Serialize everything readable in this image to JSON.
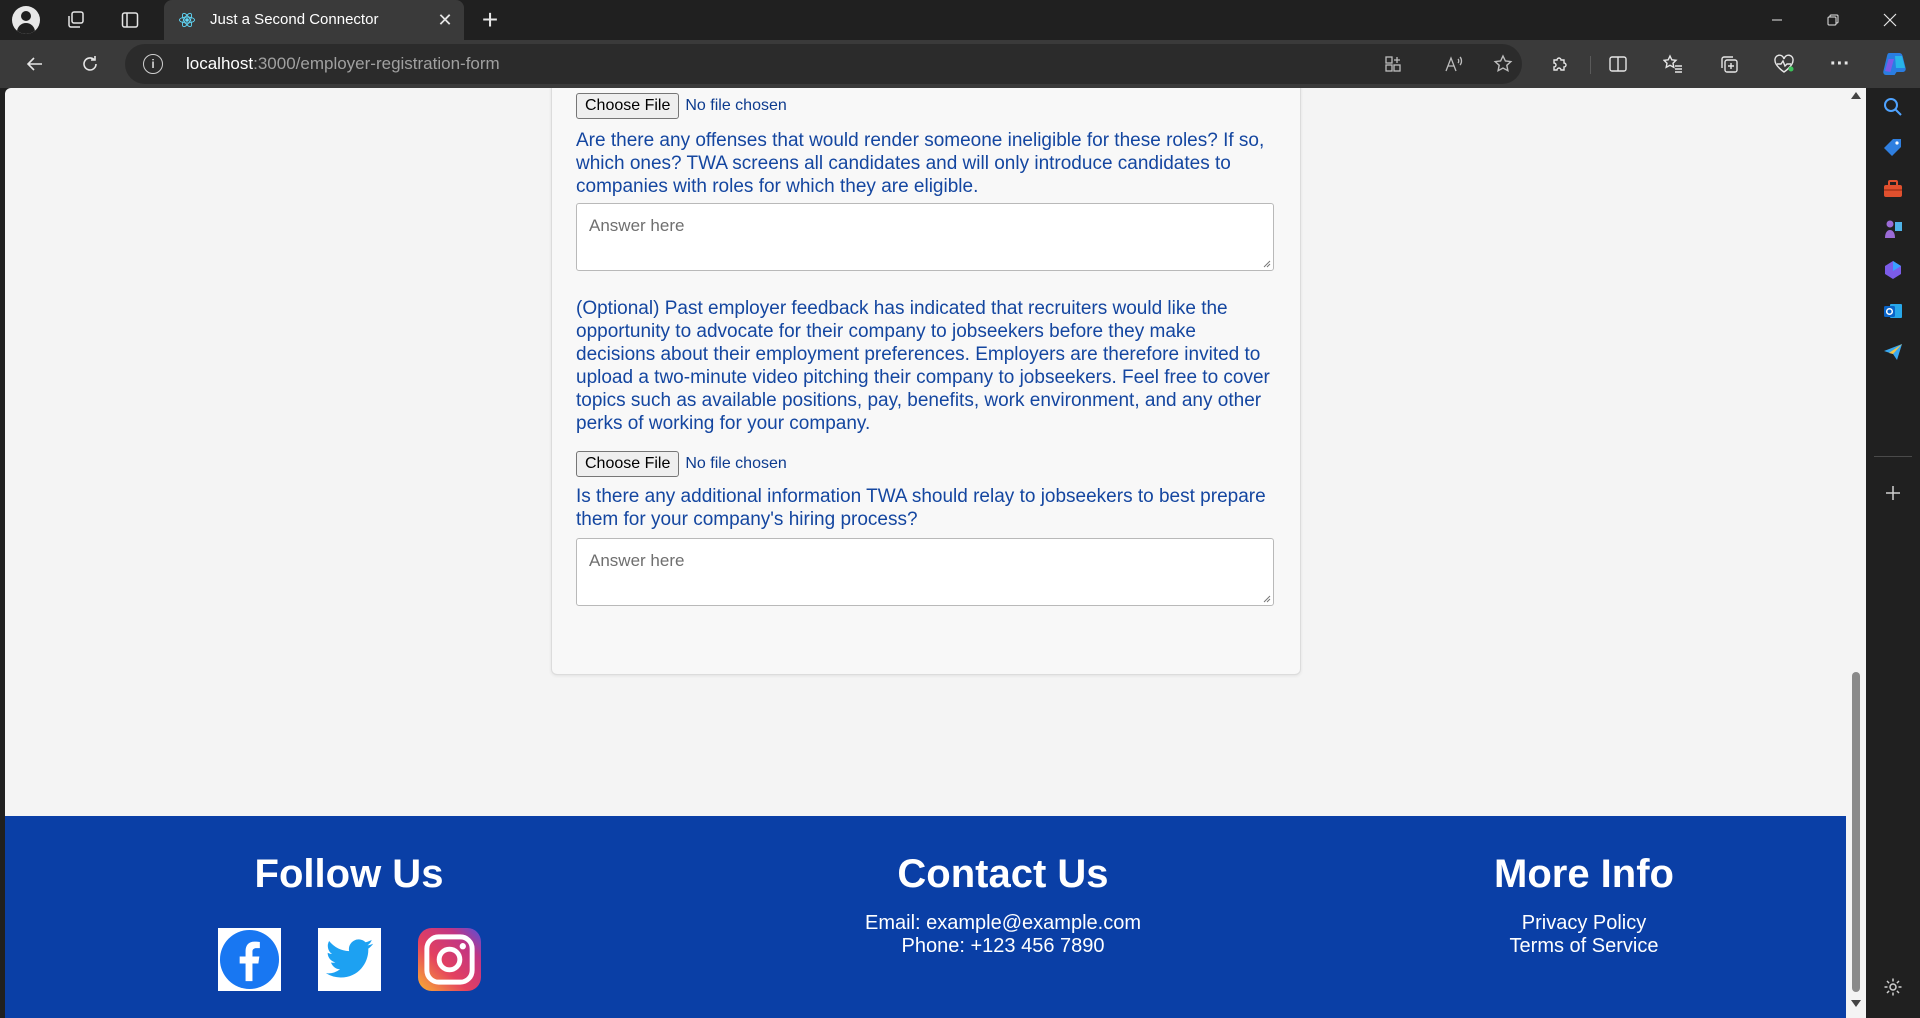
{
  "browser": {
    "tab_title": "Just a Second Connector",
    "url_host": "localhost",
    "url_rest": ":3000/employer-registration-form",
    "tab_close_glyph": "✕",
    "new_tab_glyph": "+",
    "more_glyph": "···"
  },
  "form": {
    "file_inputs": [
      {
        "button": "Choose File",
        "status": "No file chosen"
      },
      {
        "button": "Choose File",
        "status": "No file chosen"
      }
    ],
    "questions": [
      {
        "label": "Are there any offenses that would render someone ineligible for these roles? If so, which ones? TWA screens all candidates and will only introduce candidates to companies with roles for which they are eligible.",
        "placeholder": "Answer here"
      },
      {
        "label": "(Optional) Past employer feedback has indicated that recruiters would like the opportunity to advocate for their company to jobseekers before they make decisions about their employment preferences. Employers are therefore invited to upload a two-minute video pitching their company to jobseekers. Feel free to cover topics such as available positions, pay, benefits, work environment, and any other perks of working for your company."
      },
      {
        "label": "Is there any additional information TWA should relay to jobseekers to best prepare them for your company's hiring process?",
        "placeholder": "Answer here"
      }
    ]
  },
  "footer": {
    "follow": {
      "heading": "Follow Us",
      "icons": [
        "facebook-icon",
        "twitter-icon",
        "instagram-icon"
      ]
    },
    "contact": {
      "heading": "Contact Us",
      "email": "Email: example@example.com",
      "phone": "Phone: +123 456 7890"
    },
    "more_info": {
      "heading": "More Info",
      "privacy": "Privacy Policy",
      "terms": "Terms of Service"
    }
  },
  "colors": {
    "footer_bg": "#0a3fa6",
    "question_text": "#1446a0",
    "page_bg": "#f4f4f4",
    "browser_dark": "#202020"
  }
}
